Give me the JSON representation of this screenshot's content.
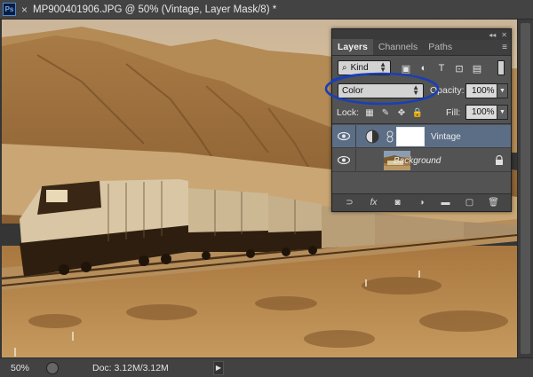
{
  "window": {
    "app_badge": "Ps",
    "close_glyph": "×",
    "title": "MP900401906.JPG @ 50% (Vintage, Layer Mask/8) *"
  },
  "status": {
    "zoom": "50%",
    "doc_info": "Doc: 3.12M/3.12M",
    "arrow": "▶"
  },
  "panel": {
    "tabs": [
      "Layers",
      "Channels",
      "Paths"
    ],
    "active_tab": "Layers",
    "collapse_glyph": "◂◂",
    "close_glyph": "✕",
    "menu_glyph": "≡",
    "kind_filter": "Kind",
    "blend_mode": "Color",
    "opacity_label": "Opacity:",
    "opacity_value": "100%",
    "lock_label": "Lock:",
    "fill_label": "Fill:",
    "fill_value": "100%",
    "filter_icons": [
      "image-filter-icon",
      "adjustment-filter-icon",
      "type-filter-icon",
      "shape-filter-icon",
      "smart-object-filter-icon"
    ],
    "filter_glyphs": [
      "▣",
      "◐",
      "T",
      "⊡",
      "▤"
    ],
    "lock_icons": [
      "lock-transparent-pixels-icon",
      "lock-image-pixels-icon",
      "lock-position-icon",
      "lock-all-icon"
    ],
    "lock_glyphs": [
      "▦",
      "✎",
      "✥",
      "🔒"
    ],
    "layers": [
      {
        "name": "Vintage",
        "selected": true,
        "italic": false,
        "visible": true
      },
      {
        "name": "Background",
        "selected": false,
        "italic": true,
        "visible": true,
        "locked": true
      }
    ],
    "bottom_icons": [
      "link-layers-icon",
      "layer-style-icon",
      "add-mask-icon",
      "new-adjustment-icon",
      "new-group-icon",
      "new-layer-icon",
      "delete-layer-icon"
    ],
    "bottom_glyphs": [
      "⊃",
      "fx",
      "◙",
      "◑",
      "▬",
      "▢",
      "🗑"
    ]
  },
  "annotation": {
    "color": "#1a3fb5",
    "shape": "ellipse-circling-blend-mode"
  },
  "colors": {
    "selected_layer": "#5c6e86",
    "panel_bg": "#535353",
    "sepia_light": "#d9b98a",
    "sepia_dark": "#5a3d1c"
  }
}
